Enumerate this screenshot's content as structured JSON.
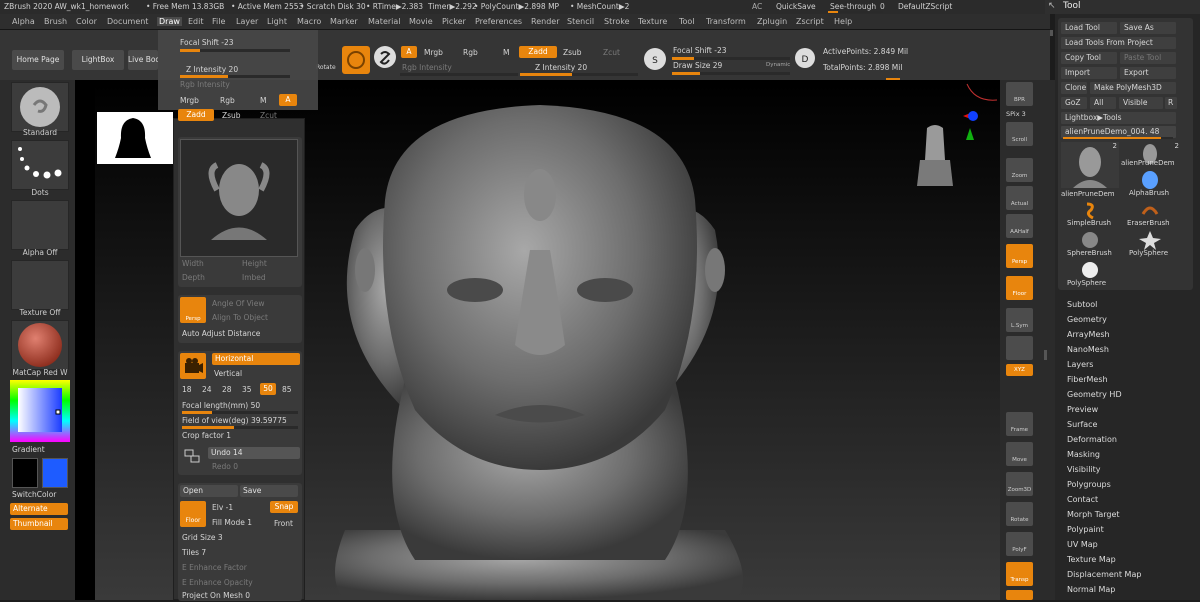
{
  "titlebar": {
    "app": "ZBrush 2020 AW_wk1_homework",
    "free_mem": "• Free Mem 13.83GB",
    "active_mem": "• Active Mem 2553",
    "scratch": "• Scratch Disk 30",
    "rtime": "• RTime▶2.383",
    "timer": "Timer▶2.292",
    "polycount": "• PolyCount▶2.898 MP",
    "meshcount": "• MeshCount▶2",
    "ac": "AC",
    "quicksave": "QuickSave",
    "seethrough": "See-through",
    "seethrough_val": "0",
    "script": "DefaultZScript",
    "tool_title": "Tool"
  },
  "menu": [
    "Alpha",
    "Brush",
    "Color",
    "Document",
    "Draw",
    "Edit",
    "File",
    "Layer",
    "Light",
    "Macro",
    "Marker",
    "Material",
    "Movie",
    "Picker",
    "Preferences",
    "Render",
    "Stencil",
    "Stroke",
    "Texture",
    "Tool",
    "Transform",
    "Zplugin",
    "Zscript",
    "Help"
  ],
  "topbar": {
    "home": "Home Page",
    "lightbox": "LightBox",
    "livebool": "Live Boolean",
    "rotate": "Rotate",
    "a": "A",
    "mrgb": "Mrgb",
    "rgb": "Rgb",
    "m": "M",
    "zadd": "Zadd",
    "zsub": "Zsub",
    "zcut": "Zcut",
    "rgb_intensity": "Rgb Intensity",
    "z_intensity": "Z Intensity 20",
    "focal_shift": "Focal Shift -23",
    "draw_size": "Draw Size 29",
    "dynamic": "Dynamic",
    "active_points": "ActivePoints: 2.849 Mil",
    "total_points": "TotalPoints: 2.898 Mil"
  },
  "left": {
    "standard": "Standard",
    "dots": "Dots",
    "alpha_off": "Alpha Off",
    "texture_off": "Texture Off",
    "matcap": "MatCap Red W",
    "gradient": "Gradient",
    "switchcolor": "SwitchColor",
    "alternate": "Alternate",
    "thumbnail": "Thumbnail"
  },
  "float": {
    "focal_shift": "Focal Shift -23",
    "z_intensity": "Z Intensity 20",
    "rgb_intensity": "Rgb Intensity",
    "mrgb": "Mrgb",
    "rgb": "Rgb",
    "m": "M",
    "a": "A",
    "zadd": "Zadd",
    "zsub": "Zsub",
    "zcut": "Zcut"
  },
  "panel": {
    "width": "Width",
    "height": "Height",
    "depth": "Depth",
    "imbed": "Imbed",
    "persp": "Persp",
    "angle_of_view": "Angle Of View",
    "align_to_object": "Align To Object",
    "auto_adjust": "Auto Adjust Distance",
    "horizontal": "Horizontal",
    "vertical": "Vertical",
    "focal_values": [
      "18",
      "24",
      "28",
      "35",
      "50",
      "85"
    ],
    "focal_length": "Focal length(mm) 50",
    "fov": "Field of view(deg) 39.59775",
    "crop": "Crop factor 1",
    "undo": "Undo 14",
    "redo": "Redo 0",
    "open": "Open",
    "save": "Save",
    "elv": "Elv -1",
    "snap": "Snap",
    "floor": "Floor",
    "fill_mode": "Fill Mode 1",
    "front": "Front",
    "grid_size": "Grid Size 3",
    "tiles": "Tiles 7",
    "enhance_factor": "E Enhance Factor",
    "enhance_opacity": "E Enhance Opacity",
    "project": "Project On Mesh 0"
  },
  "righttray": {
    "bpr": "BPR",
    "spix": "SPix 3",
    "buttons": [
      "Scroll",
      "Zoom",
      "Actual",
      "AAHalf",
      "Persp",
      "Floor",
      "L.Sym",
      "",
      "XYZ",
      "",
      "Frame",
      "Move",
      "Zoom3D",
      "Rotate",
      "PolyF",
      "Transp"
    ]
  },
  "tool": {
    "load": "Load Tool",
    "save_as": "Save As",
    "load_from_project": "Load Tools From Project",
    "copy": "Copy Tool",
    "paste": "Paste Tool",
    "import": "Import",
    "export": "Export",
    "clone": "Clone",
    "make_polymesh": "Make PolyMesh3D",
    "goz": "GoZ",
    "all": "All",
    "visible": "Visible",
    "r": "R",
    "lightbox_tools": "Lightbox▶Tools",
    "current": "alienPruneDemo_004. 48",
    "thumbs": [
      {
        "name": "alienPruneDem",
        "count": "2"
      },
      {
        "name": "alienPruneDem",
        "count": "2"
      },
      {
        "name": "AlphaBrush",
        "count": ""
      },
      {
        "name": "SimpleBrush",
        "count": ""
      },
      {
        "name": "EraserBrush",
        "count": ""
      },
      {
        "name": "SphereBrush",
        "count": ""
      },
      {
        "name": "PolySphere",
        "count": ""
      },
      {
        "name": "PolySphere",
        "count": ""
      }
    ],
    "subpalettes": [
      "Subtool",
      "Geometry",
      "ArrayMesh",
      "NanoMesh",
      "Layers",
      "FiberMesh",
      "Geometry HD",
      "Preview",
      "Surface",
      "Deformation",
      "Masking",
      "Visibility",
      "Polygroups",
      "Contact",
      "Morph Target",
      "Polypaint",
      "UV Map",
      "Texture Map",
      "Displacement Map",
      "Normal Map"
    ]
  },
  "colors": {
    "accent": "#e8850d",
    "panel": "#2f2f2f",
    "viewport": "#000000"
  }
}
